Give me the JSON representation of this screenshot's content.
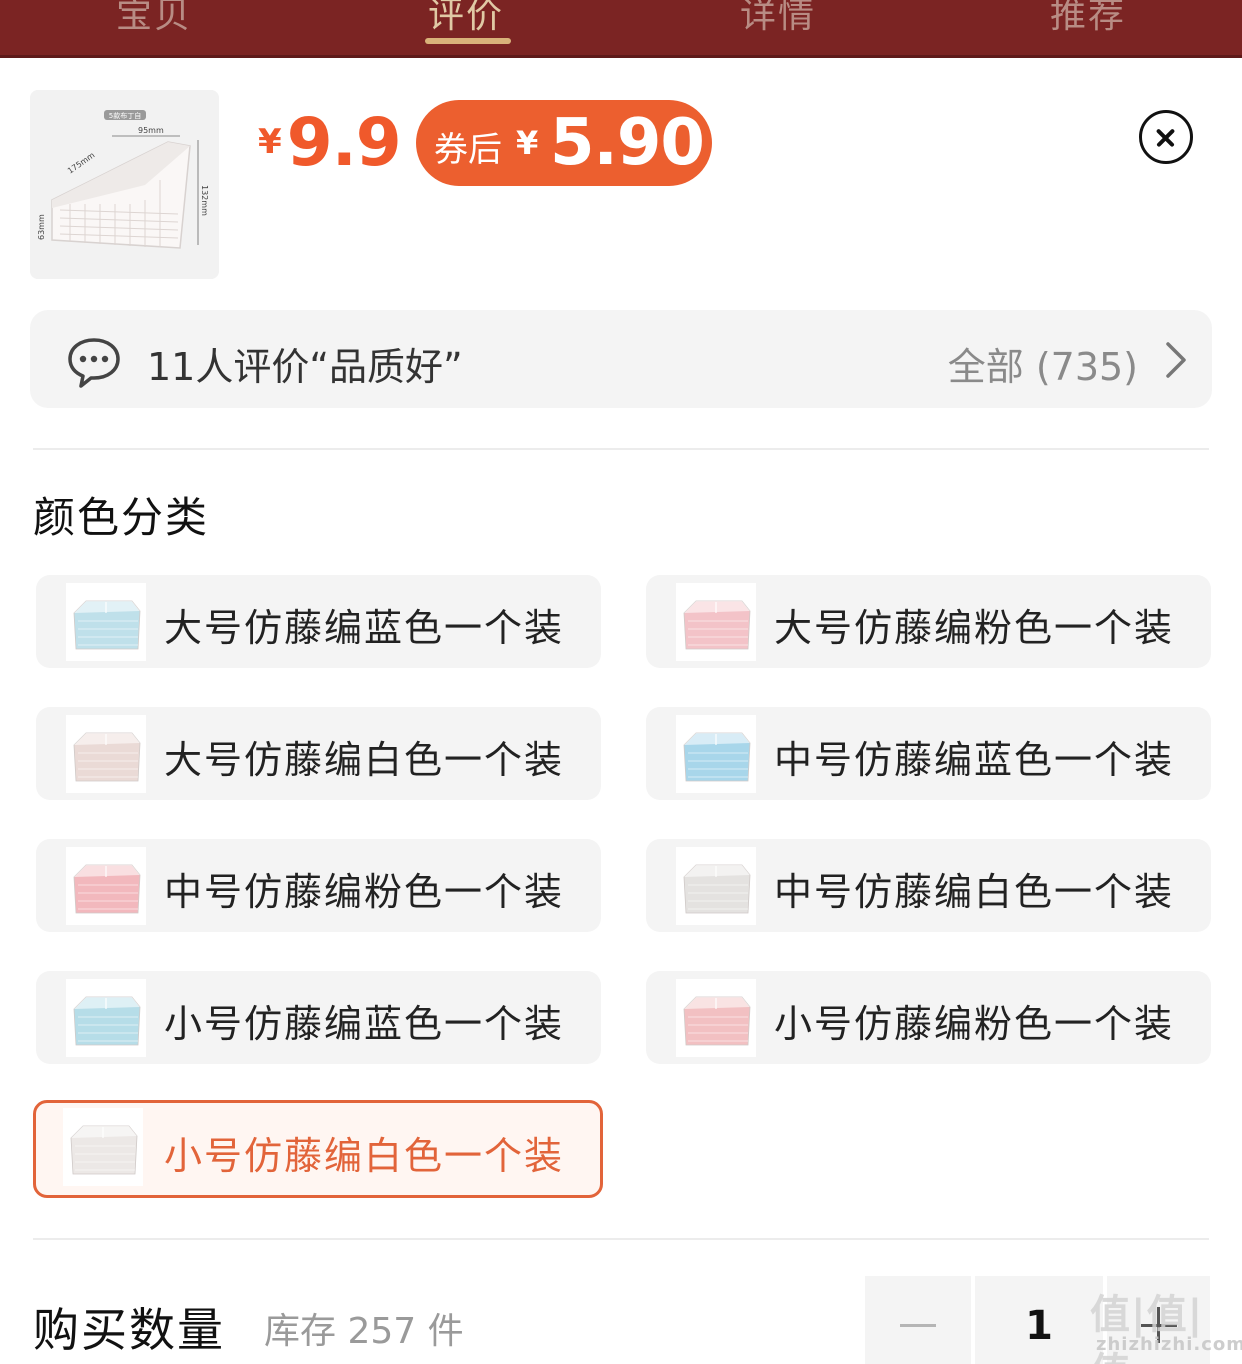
{
  "nav": {
    "tabs": [
      {
        "label": "宝贝"
      },
      {
        "label": "评价"
      },
      {
        "label": "详情"
      },
      {
        "label": "推荐"
      }
    ],
    "active_index": 1
  },
  "product": {
    "thumb_labels": {
      "badge": "5款布丁自",
      "width": "95mm",
      "depth": "175mm",
      "height": "132mm",
      "side": "63mm"
    },
    "price_symbol": "¥",
    "price": "9.9",
    "coupon_label": "券后",
    "coupon_symbol": "¥",
    "coupon_price": "5.90",
    "close_icon": "close-circle-icon"
  },
  "review": {
    "icon": "chat-bubble-icon",
    "text": "11人评价“品质好”",
    "all": "全部 (735)",
    "chevron": "chevron-right-icon"
  },
  "color_section": {
    "title": "颜色分类",
    "options": [
      {
        "label": "大号仿藤编蓝色一个装",
        "swatch": "#bfe0ea",
        "selected": false
      },
      {
        "label": "大号仿藤编粉色一个装",
        "swatch": "#f3c3c8",
        "selected": false
      },
      {
        "label": "大号仿藤编白色一个装",
        "swatch": "#eadad6",
        "selected": false
      },
      {
        "label": "中号仿藤编蓝色一个装",
        "swatch": "#a8d6ea",
        "selected": false
      },
      {
        "label": "中号仿藤编粉色一个装",
        "swatch": "#f2b8bd",
        "selected": false
      },
      {
        "label": "中号仿藤编白色一个装",
        "swatch": "#e4e2e0",
        "selected": false
      },
      {
        "label": "小号仿藤编蓝色一个装",
        "swatch": "#b6dde8",
        "selected": false
      },
      {
        "label": "小号仿藤编粉色一个装",
        "swatch": "#f2c0c2",
        "selected": false
      },
      {
        "label": "小号仿藤编白色一个装",
        "swatch": "#ece8e6",
        "selected": true
      }
    ]
  },
  "quantity": {
    "title": "购买数量",
    "stock": "库存 257 件",
    "value": "1"
  },
  "watermark": {
    "text": "值|值|值",
    "site": "zhizhizhi.com"
  },
  "colors": {
    "nav_bg": "#7b2423",
    "accent": "#ec5f2f",
    "price": "#f0592b"
  }
}
